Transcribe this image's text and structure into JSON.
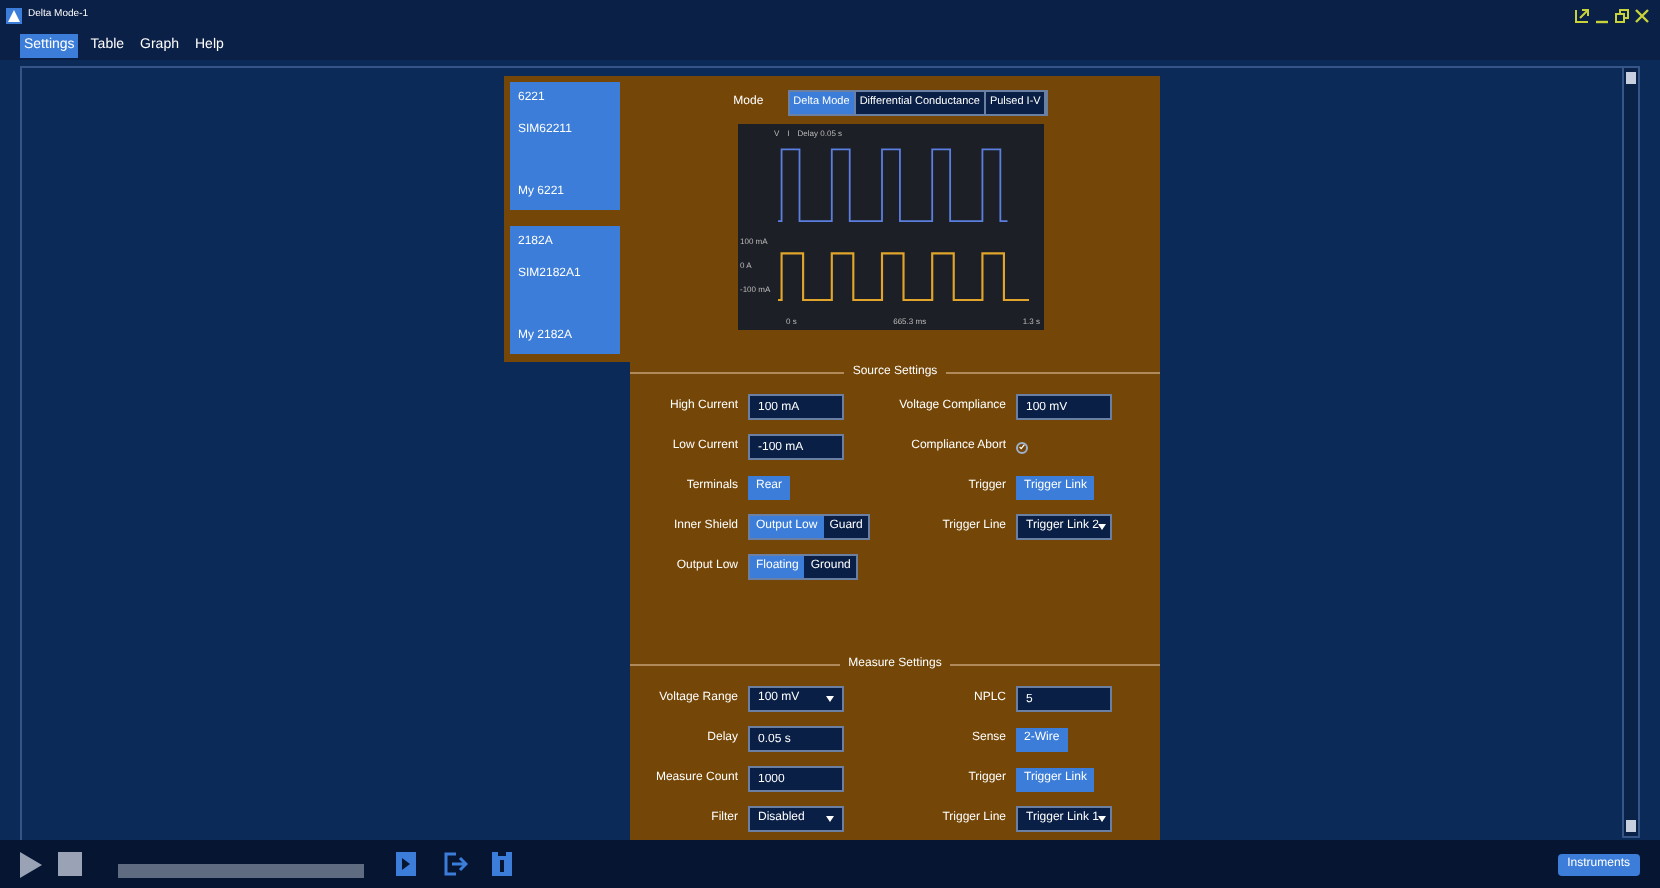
{
  "window": {
    "title": "Delta Mode-1"
  },
  "menu": [
    {
      "label": "Settings",
      "selected": true
    },
    {
      "label": "Table",
      "selected": false
    },
    {
      "label": "Graph",
      "selected": false
    },
    {
      "label": "Help",
      "selected": false
    }
  ],
  "instruments": [
    {
      "model": "6221",
      "id": "SIM62211",
      "name": "My 6221"
    },
    {
      "model": "2182A",
      "id": "SIM2182A1",
      "name": "My 2182A"
    }
  ],
  "mode": {
    "label": "Mode",
    "options": [
      {
        "label": "Delta Mode",
        "selected": true
      },
      {
        "label": "Differential Conductance",
        "selected": false
      },
      {
        "label": "Pulsed I-V",
        "selected": false
      }
    ]
  },
  "preview": {
    "legend": [
      "V",
      "I",
      "Delay 0.05 s"
    ],
    "y_labels": [
      "100 mA",
      "0 A",
      "-100 mA"
    ],
    "x_labels": [
      "0 s",
      "665.3 ms",
      "1.3 s"
    ]
  },
  "sections": [
    {
      "title": "Source Settings",
      "rows": [
        [
          {
            "label": "High Current",
            "kind": "input",
            "value": "100 mA"
          },
          {
            "label": "Voltage Compliance",
            "kind": "input",
            "value": "100 mV"
          }
        ],
        [
          {
            "label": "Low Current",
            "kind": "input",
            "value": "-100 mA"
          },
          {
            "label": "Compliance Abort",
            "kind": "checkbox",
            "checked": true
          }
        ],
        [
          {
            "label": "Terminals",
            "kind": "toggle",
            "value": "Rear",
            "on": true
          },
          {
            "label": "Trigger",
            "kind": "toggle",
            "value": "Trigger Link",
            "on": true
          }
        ],
        [
          {
            "label": "Inner Shield",
            "kind": "segmented",
            "options": [
              {
                "label": "Output Low",
                "selected": true
              },
              {
                "label": "Guard",
                "selected": false
              }
            ]
          },
          {
            "label": "Trigger Line",
            "kind": "select",
            "value": "Trigger Link 2"
          }
        ],
        [
          {
            "label": "Output Low",
            "kind": "segmented",
            "options": [
              {
                "label": "Floating",
                "selected": true
              },
              {
                "label": "Ground",
                "selected": false
              }
            ]
          }
        ]
      ]
    },
    {
      "title": "Measure Settings",
      "rows": [
        [
          {
            "label": "Voltage Range",
            "kind": "select",
            "value": "100 mV"
          },
          {
            "label": "NPLC",
            "kind": "input",
            "value": "5"
          }
        ],
        [
          {
            "label": "Delay",
            "kind": "input",
            "value": "0.05 s"
          },
          {
            "label": "Sense",
            "kind": "toggle",
            "value": "2-Wire",
            "on": true
          }
        ],
        [
          {
            "label": "Measure Count",
            "kind": "input",
            "value": "1000"
          },
          {
            "label": "Trigger",
            "kind": "toggle",
            "value": "Trigger Link",
            "on": true
          }
        ],
        [
          {
            "label": "Filter",
            "kind": "select",
            "value": "Disabled"
          },
          {
            "label": "Trigger Line",
            "kind": "select",
            "value": "Trigger Link 1"
          }
        ]
      ]
    }
  ],
  "toolbar": {
    "button": "Instruments"
  }
}
